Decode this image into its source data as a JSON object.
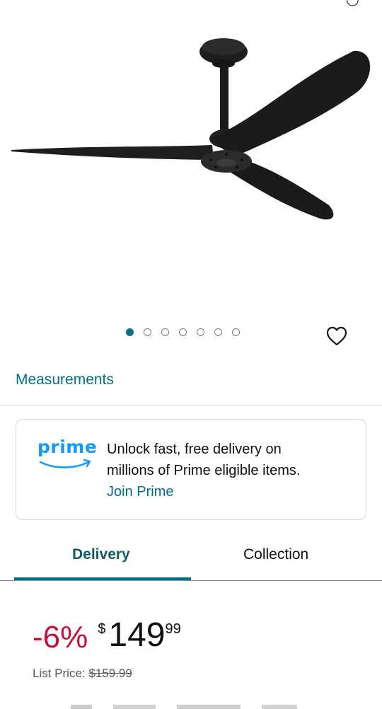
{
  "product": {
    "image_alt": "Black three-blade ceiling fan",
    "carousel": {
      "count": 7,
      "active_index": 0
    }
  },
  "icons": {
    "wishlist": "heart-icon",
    "prime_smile": "prime-smile-icon"
  },
  "measurements": {
    "label": "Measurements"
  },
  "prime": {
    "logo": "prime",
    "line1": "Unlock fast, free delivery on",
    "line2": "millions of Prime eligible items.",
    "join_label": "Join Prime"
  },
  "tabs": {
    "delivery_label": "Delivery",
    "collection_label": "Collection",
    "active": "Delivery"
  },
  "price": {
    "discount": "-6%",
    "currency": "$",
    "whole": "149",
    "fraction": "99",
    "list_label": "List Price:",
    "list_value": "$159.99"
  },
  "colors": {
    "accent_teal": "#007185",
    "prime_blue": "#1399ff",
    "discount_red": "#cc0c39"
  }
}
